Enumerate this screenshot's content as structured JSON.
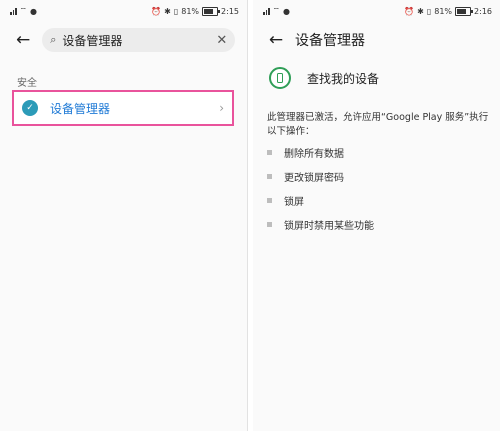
{
  "left": {
    "status": {
      "time": "2:15",
      "battery": "81%"
    },
    "search": {
      "value": "设备管理器"
    },
    "section_label": "安全",
    "result_label": "设备管理器"
  },
  "right": {
    "status": {
      "time": "2:16",
      "battery": "81%"
    },
    "title": "设备管理器",
    "app_name": "查找我的设备",
    "description": "此管理器已激活，允许应用“Google Play 服务”执行以下操作：",
    "permissions": [
      "删除所有数据",
      "更改锁屏密码",
      "锁屏",
      "锁屏时禁用某些功能"
    ]
  },
  "icons": {
    "back": "back-arrow-icon",
    "search": "search-icon",
    "clear": "clear-icon",
    "shield": "shield-check-icon",
    "chevron": "chevron-right-icon",
    "device": "find-my-device-icon"
  },
  "colors": {
    "highlight_border": "#e9539c",
    "link_blue": "#1f7ad6",
    "shield_teal": "#2c9bb8",
    "device_green": "#2f9e57"
  }
}
